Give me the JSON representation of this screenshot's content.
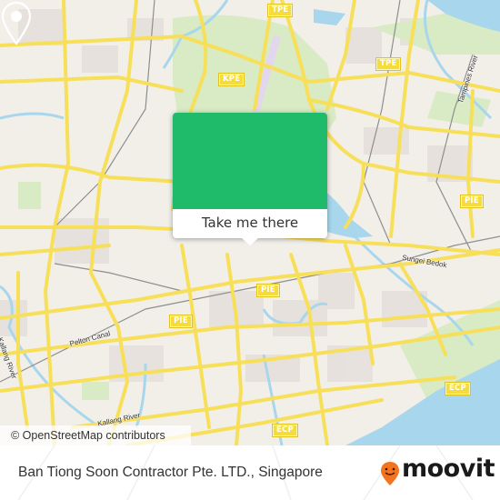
{
  "map": {
    "colors": {
      "land": "#f2efe9",
      "road": "#f7df5a",
      "water": "#a8d6ec",
      "park": "#d8ebc4",
      "residential": "#e6e0dc",
      "runway": "#e3d6ef",
      "rail": "#8e8e8e",
      "accent": "#1fba6a"
    },
    "road_shields": [
      {
        "label": "TPE",
        "id": "tpe-north"
      },
      {
        "label": "TPE",
        "id": "tpe-east"
      },
      {
        "label": "KPE",
        "id": "kpe"
      },
      {
        "label": "PIE",
        "id": "pie-east"
      },
      {
        "label": "PIE",
        "id": "pie-center"
      },
      {
        "label": "PIE",
        "id": "pie-west"
      },
      {
        "label": "ECP",
        "id": "ecp-east"
      },
      {
        "label": "ECP",
        "id": "ecp-south"
      }
    ],
    "place_labels": [
      {
        "label": "Tampines River"
      },
      {
        "label": "Sungei Bedok"
      },
      {
        "label": "Kallang River"
      },
      {
        "label": "Pelton Canal"
      },
      {
        "label": "Kallang River"
      }
    ],
    "attribution": "© OpenStreetMap contributors"
  },
  "popup": {
    "icon": "map-pin-icon",
    "button_label": "Take me there"
  },
  "footer": {
    "title": "Ban Tiong Soon Contractor Pte. LTD., Singapore",
    "brand": "moovit",
    "brand_color": "#f3731e"
  }
}
